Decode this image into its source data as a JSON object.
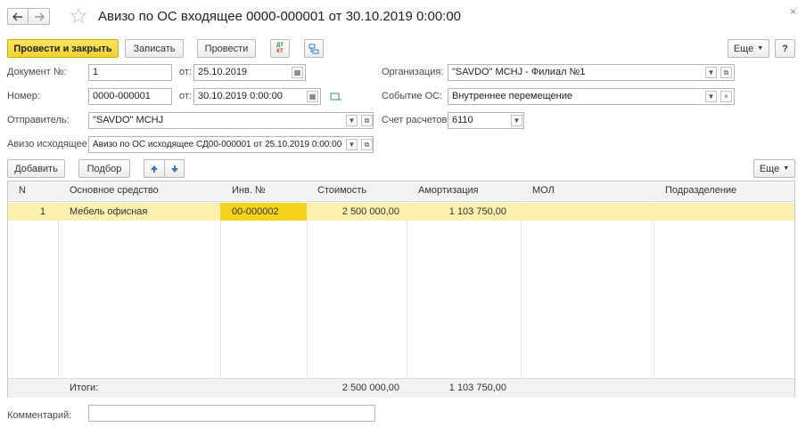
{
  "window": {
    "title": "Авизо по ОС входящее 0000-000001 от 30.10.2019 0:00:00",
    "close_glyph": "×"
  },
  "toolbar": {
    "post_close_label": "Провести и закрыть",
    "save_label": "Записать",
    "post_label": "Провести",
    "dtkt_top": "ДТ",
    "dtkt_bottom": "КТ",
    "more_label": "Еще",
    "help_label": "?"
  },
  "form": {
    "doc_no_label": "Документ №:",
    "doc_no_value": "1",
    "doc_from_label": "от:",
    "doc_date_value": "25.10.2019",
    "org_label": "Организация:",
    "org_value": "\"SAVDO\" MCHJ - Филиал №1",
    "number_label": "Номер:",
    "number_value": "0000-000001",
    "number_from_label": "от:",
    "number_date_value": "30.10.2019  0:00:00",
    "event_label": "Событие ОС:",
    "event_value": "Внутреннее перемещение",
    "sender_label": "Отправитель:",
    "sender_value": "\"SAVDO\" MCHJ",
    "account_label": "Счет расчетов:",
    "account_value": "6110",
    "outgoing_label": "Авизо исходящее:",
    "outgoing_value": "Авизо по ОС исходящее СД00-000001 от 25.10.2019 0:00:00",
    "comment_label": "Комментарий:",
    "comment_value": ""
  },
  "table_toolbar": {
    "add_label": "Добавить",
    "select_label": "Подбор",
    "more_label": "Еще"
  },
  "table": {
    "columns": [
      "N",
      "Основное средство",
      "Инв. №",
      "Стоимость",
      "Амортизация",
      "МОЛ",
      "Подразделение"
    ],
    "rows": [
      {
        "n": "1",
        "asset": "Мебель офисная",
        "inv": "00-000002",
        "cost": "2 500 000,00",
        "amort": "1 103 750,00",
        "mol": "",
        "dept": ""
      }
    ],
    "totals": {
      "label": "Итоги:",
      "cost": "2 500 000,00",
      "amort": "1 103 750,00"
    }
  },
  "colors": {
    "accent": "#f2d22e",
    "selected_row": "#fbefad",
    "selected_cell": "#f5d31c",
    "arrow_blue": "#3b78c4"
  },
  "icons": [
    "back-arrow-icon",
    "forward-arrow-icon",
    "star-icon",
    "calendar-icon",
    "open-icon",
    "dropdown-icon",
    "clear-icon",
    "arrow-up-icon",
    "arrow-down-icon",
    "structure-icon",
    "dtkt-icon"
  ]
}
